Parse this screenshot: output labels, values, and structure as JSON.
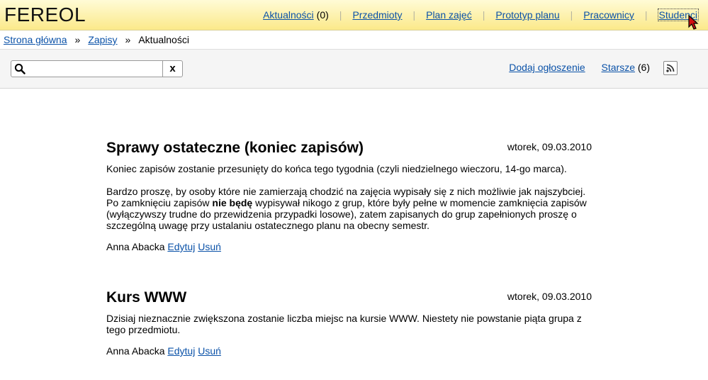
{
  "header": {
    "logo": "FEREOL",
    "nav": [
      {
        "label": "Aktualności",
        "count": "(0)"
      },
      {
        "label": "Przedmioty"
      },
      {
        "label": "Plan zajęć"
      },
      {
        "label": "Prototyp planu"
      },
      {
        "label": "Pracownicy"
      },
      {
        "label": "Studenci"
      }
    ]
  },
  "breadcrumb": {
    "items": [
      "Strona główna",
      "Zapisy",
      "Aktualności"
    ],
    "separator": "»"
  },
  "toolbar": {
    "search_value": "",
    "clear_label": "x",
    "add_label": "Dodaj ogłoszenie",
    "older_label": "Starsze",
    "older_count": "(6)"
  },
  "posts": [
    {
      "title": "Sprawy ostateczne (koniec zapisów)",
      "date": "wtorek, 09.03.2010",
      "p1": "Koniec zapisów zostanie przesunięty do końca tego tygodnia (czyli niedzielnego wieczoru, 14-go marca).",
      "p2_before": "Bardzo proszę, by osoby które nie zamierzają chodzić na zajęcia wypisały się z nich możliwie jak najszybciej. Po zamknięciu zapisów ",
      "p2_bold": "nie będę",
      "p2_after": " wypisywał nikogo z grup, które były pełne w momencie zamknięcia zapisów (wyłączywszy trudne do przewidzenia przypadki losowe), zatem zapisanych do grup zapełnionych proszę o szczególną uwagę przy ustalaniu ostatecznego planu na obecny semestr.",
      "author": "Anna Abacka",
      "edit": "Edytuj",
      "delete": "Usuń"
    },
    {
      "title": "Kurs WWW",
      "date": "wtorek, 09.03.2010",
      "p1": "Dzisiaj nieznacznie zwiększona zostanie liczba miejsc na kursie WWW. Niestety nie powstanie piąta grupa z tego przedmiotu.",
      "author": "Anna Abacka",
      "edit": "Edytuj",
      "delete": "Usuń"
    }
  ],
  "colors": {
    "link": "#0b52a8",
    "header_top": "#fffbd6",
    "header_bottom": "#fbe98a",
    "toolbar_bg": "#f5f5f5"
  },
  "icons": [
    "search-icon",
    "rss-icon",
    "mouse-cursor-icon"
  ]
}
